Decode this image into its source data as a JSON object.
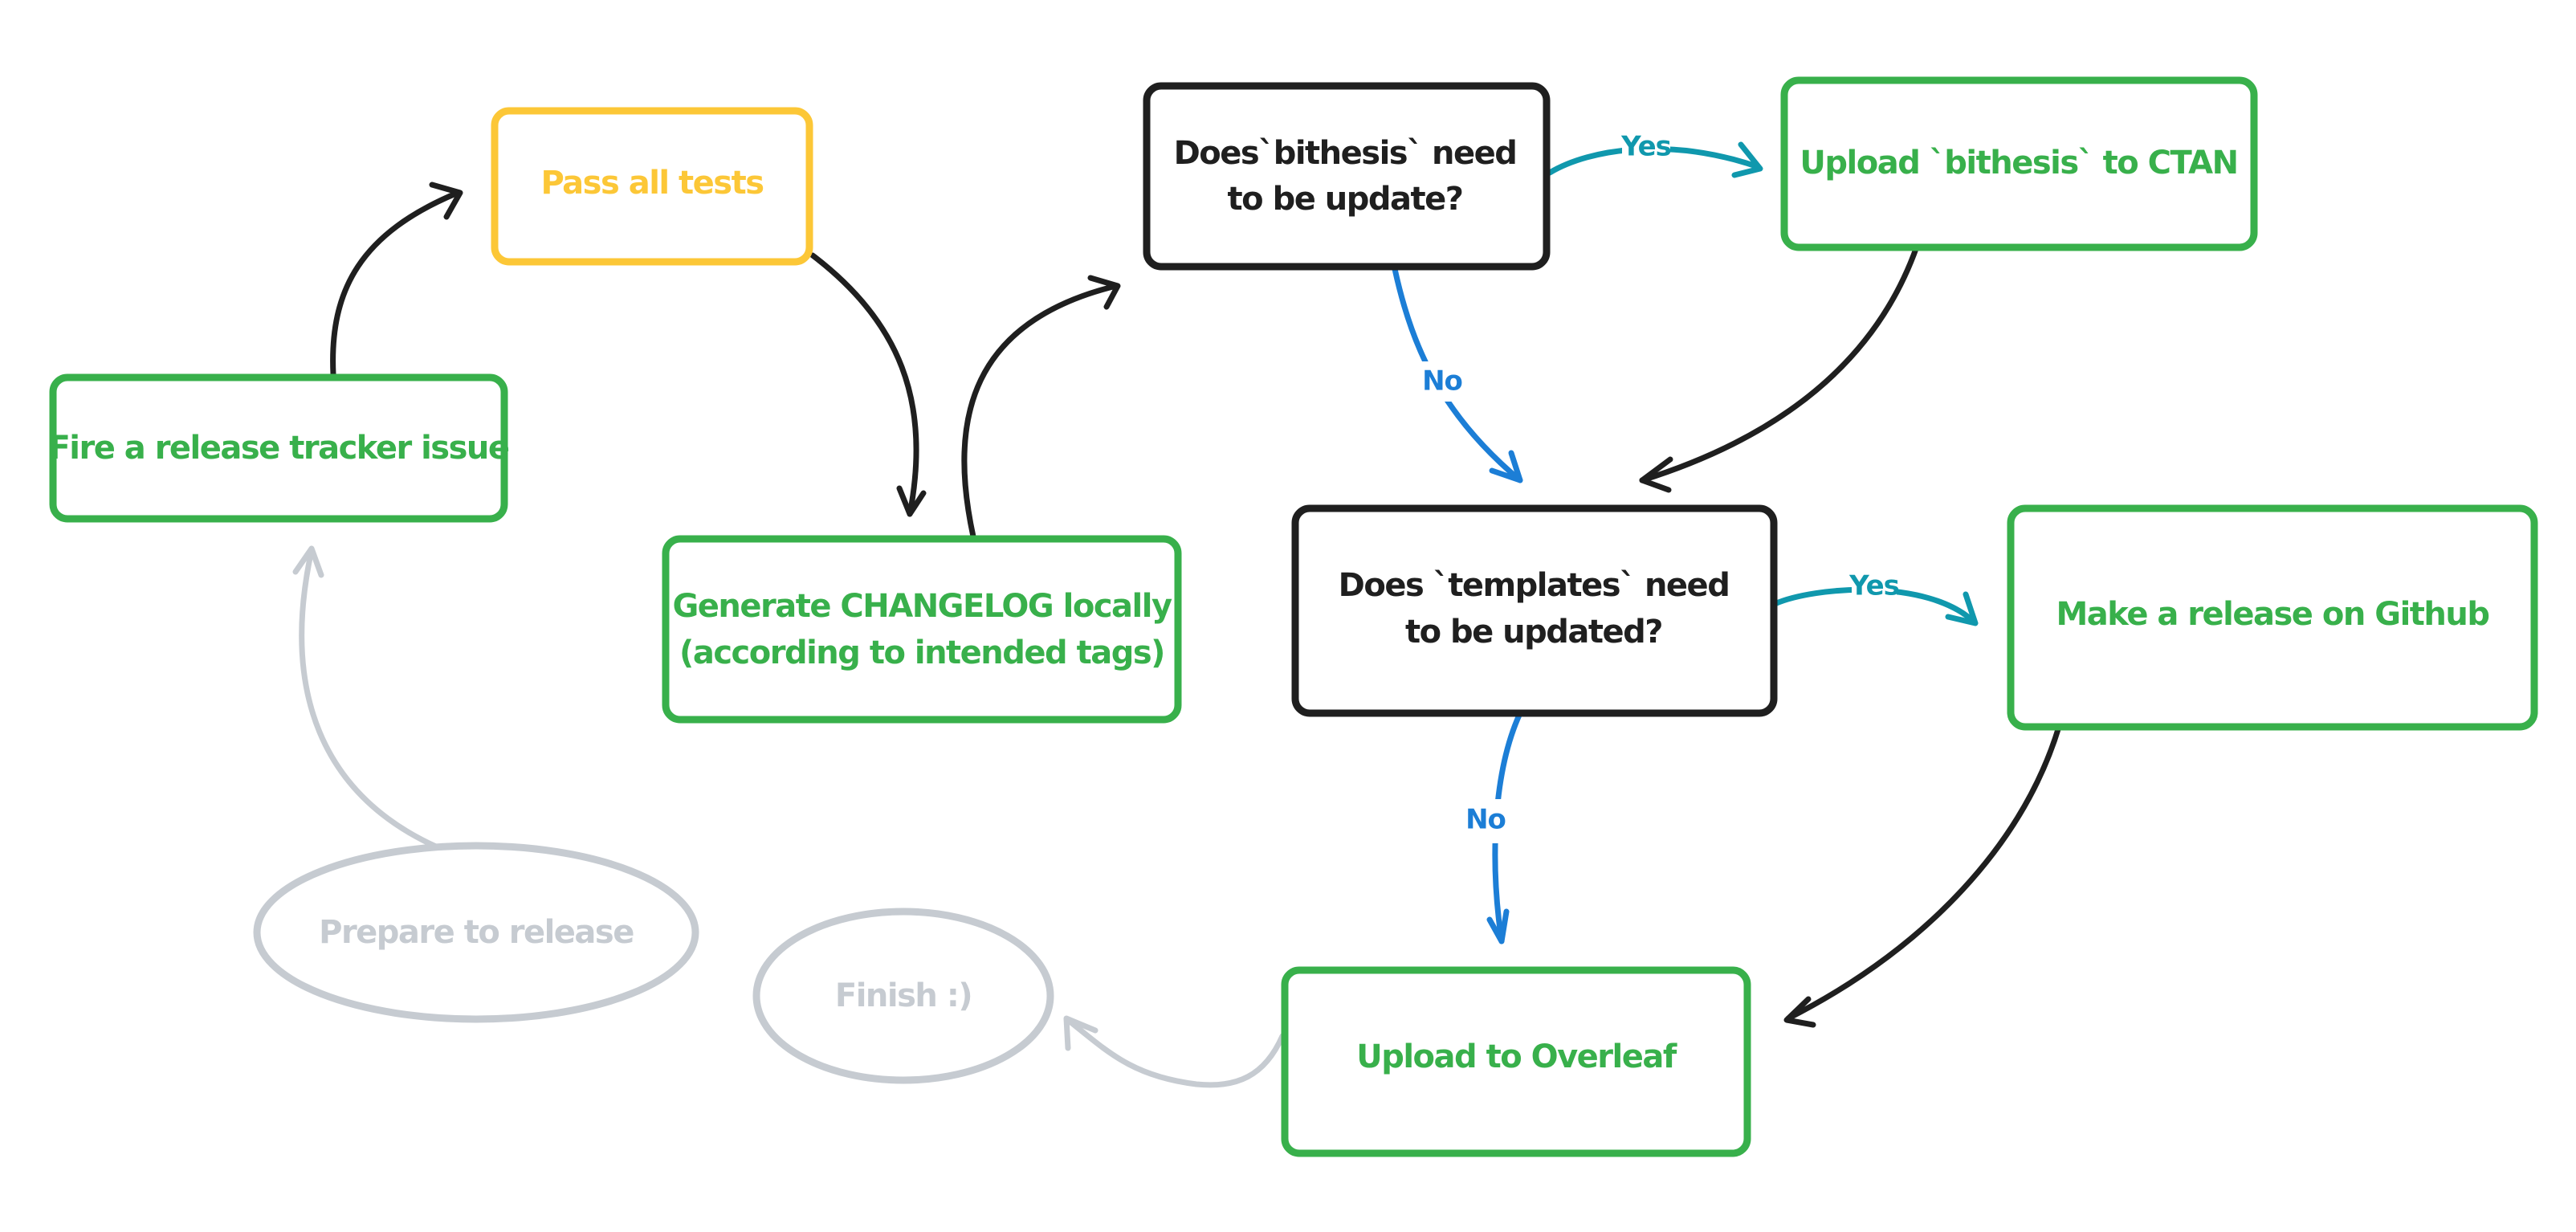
{
  "colors": {
    "green": "#38b04b",
    "yellow": "#fcc737",
    "black": "#1f1f1f",
    "grey": "#c6cbd1",
    "teal": "#1098ad",
    "blue": "#1c7ed6"
  },
  "nodes": {
    "prepare": {
      "label": "Prepare to release",
      "shape": "ellipse",
      "color": "grey"
    },
    "tracker": {
      "label": "Fire a release tracker issue",
      "shape": "rect",
      "color": "green"
    },
    "tests": {
      "label": "Pass all tests",
      "shape": "rect",
      "color": "yellow"
    },
    "changelog": {
      "lines": [
        "Generate CHANGELOG locally",
        "(according to intended tags)"
      ],
      "shape": "rect",
      "color": "green"
    },
    "bithesis_q": {
      "lines": [
        "Does`bithesis` need",
        "to be update?"
      ],
      "shape": "rect",
      "color": "black"
    },
    "ctan": {
      "label": "Upload `bithesis` to CTAN",
      "shape": "rect",
      "color": "green"
    },
    "templates_q": {
      "lines": [
        "Does `templates` need",
        "to be updated?"
      ],
      "shape": "rect",
      "color": "black"
    },
    "github": {
      "label": "Make a release on Github",
      "shape": "rect",
      "color": "green"
    },
    "overleaf": {
      "label": "Upload to Overleaf",
      "shape": "rect",
      "color": "green"
    },
    "finish": {
      "label": "Finish :)",
      "shape": "ellipse",
      "color": "grey"
    }
  },
  "edges": [
    {
      "from": "prepare",
      "to": "tracker",
      "label": "",
      "color": "grey"
    },
    {
      "from": "tracker",
      "to": "tests",
      "label": "",
      "color": "black"
    },
    {
      "from": "tests",
      "to": "changelog",
      "label": "",
      "color": "black"
    },
    {
      "from": "changelog",
      "to": "bithesis_q",
      "label": "",
      "color": "black"
    },
    {
      "from": "bithesis_q",
      "to": "ctan",
      "label": "Yes",
      "color": "teal"
    },
    {
      "from": "bithesis_q",
      "to": "templates_q",
      "label": "No",
      "color": "blue"
    },
    {
      "from": "ctan",
      "to": "templates_q",
      "label": "",
      "color": "black"
    },
    {
      "from": "templates_q",
      "to": "github",
      "label": "Yes",
      "color": "teal"
    },
    {
      "from": "templates_q",
      "to": "overleaf",
      "label": "No",
      "color": "blue"
    },
    {
      "from": "github",
      "to": "overleaf",
      "label": "",
      "color": "black"
    },
    {
      "from": "overleaf",
      "to": "finish",
      "label": "",
      "color": "grey"
    }
  ]
}
